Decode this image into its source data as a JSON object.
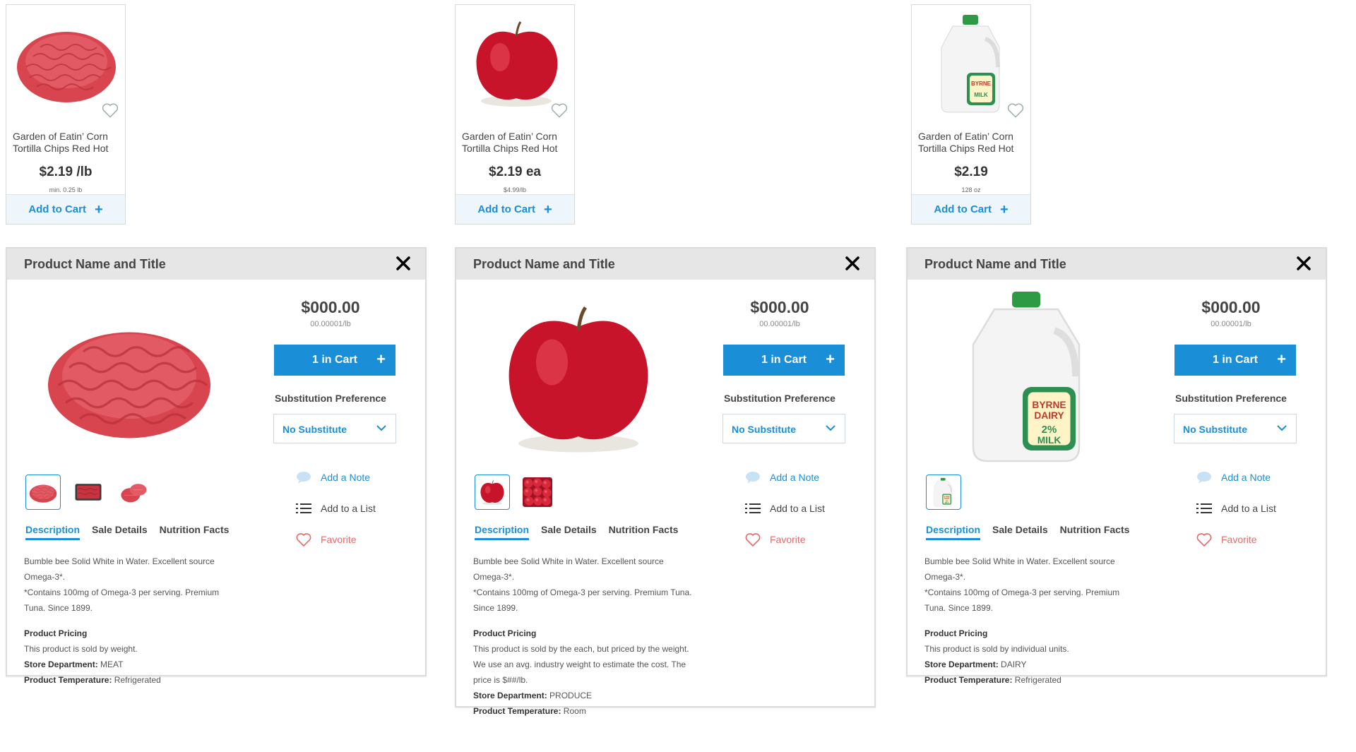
{
  "cards": [
    {
      "name": "Garden of Eatin’ Corn Tortilla Chips Red Hot",
      "price": "$2.19 /lb",
      "sub": "min. 0.25 lb",
      "add_label": "Add to Cart",
      "image": "ground-beef",
      "favorite_icon": "heart-outline-icon"
    },
    {
      "name": "Garden of Eatin’ Corn Tortilla Chips Red Hot",
      "price": "$2.19 ea",
      "sub": "$4.99/lb",
      "add_label": "Add to Cart",
      "image": "apple",
      "favorite_icon": "heart-outline-icon"
    },
    {
      "name": "Garden of Eatin’ Corn Tortilla Chips Red Hot",
      "price": "$2.19",
      "sub": "128 oz",
      "add_label": "Add to Cart",
      "image": "milk-jug",
      "favorite_icon": "heart-outline-icon"
    }
  ],
  "modals": [
    {
      "title": "Product Name and Title",
      "price": "$000.00",
      "unit_price": "00.00001/lb",
      "cart_label": "1 in Cart",
      "sub_pref_label": "Substitution Preference",
      "sub_pref_value": "No Substitute",
      "note_label": "Add a Note",
      "list_label": "Add to a List",
      "favorite_label": "Favorite",
      "tabs": [
        "Description",
        "Sale Details",
        "Nutrition Facts"
      ],
      "active_tab": "Description",
      "thumbnails": [
        "ground-beef",
        "packaged-meat",
        "meat-cuts"
      ],
      "desc_lines": [
        "Bumble bee Solid White in Water. Excellent source",
        "Omega-3*.",
        "*Contains 100mg of Omega-3 per serving. Premium",
        "Tuna. Since 1899."
      ],
      "pricing_heading": "Product Pricing",
      "pricing_lines": [
        "This product is sold by weight."
      ],
      "dept_label": "Store Department:",
      "dept_value": " MEAT",
      "temp_label": "Product Temperature:",
      "temp_value": " Refrigerated"
    },
    {
      "title": "Product Name and Title",
      "price": "$000.00",
      "unit_price": "00.00001/lb",
      "cart_label": "1 in Cart",
      "sub_pref_label": "Substitution Preference",
      "sub_pref_value": "No Substitute",
      "note_label": "Add a Note",
      "list_label": "Add to a List",
      "favorite_label": "Favorite",
      "tabs": [
        "Description",
        "Sale Details",
        "Nutrition Facts"
      ],
      "active_tab": "Description",
      "thumbnails": [
        "apple",
        "apple-pile"
      ],
      "desc_lines": [
        "Bumble bee Solid White in Water. Excellent source",
        "Omega-3*.",
        "*Contains 100mg of Omega-3 per serving. Premium Tuna.",
        "Since 1899."
      ],
      "pricing_heading": "Product Pricing",
      "pricing_lines": [
        "This product is sold by the each, but priced by the weight.",
        "We use an avg. industry weight to estimate the cost. The",
        "price is $##/lb."
      ],
      "dept_label": "Store Department:",
      "dept_value": " PRODUCE",
      "temp_label": "Product Temperature:",
      "temp_value": " Room"
    },
    {
      "title": "Product Name and Title",
      "price": "$000.00",
      "unit_price": "00.00001/lb",
      "cart_label": "1 in Cart",
      "sub_pref_label": "Substitution Preference",
      "sub_pref_value": "No Substitute",
      "note_label": "Add a Note",
      "list_label": "Add to a List",
      "favorite_label": "Favorite",
      "tabs": [
        "Description",
        "Sale Details",
        "Nutrition Facts"
      ],
      "active_tab": "Description",
      "thumbnails": [
        "milk-jug"
      ],
      "desc_lines": [
        "Bumble bee Solid White in Water. Excellent source",
        "Omega-3*.",
        "*Contains 100mg of Omega-3 per serving. Premium",
        "Tuna. Since 1899."
      ],
      "pricing_heading": "Product Pricing",
      "pricing_lines": [
        "This product is sold by individual units."
      ],
      "dept_label": "Store Department:",
      "dept_value": " DAIRY",
      "temp_label": "Product Temperature:",
      "temp_value": " Refrigerated"
    }
  ],
  "milk_label": {
    "brand_line1": "BYRNE",
    "brand_line2": "DAIRY",
    "percent": "2%",
    "product": "MILK"
  },
  "colors": {
    "accent": "#1a8ed6",
    "favorite": "#e46a6a",
    "header_bg": "#e6e6e6",
    "meat": "#d9454f",
    "apple": "#c8142a"
  }
}
